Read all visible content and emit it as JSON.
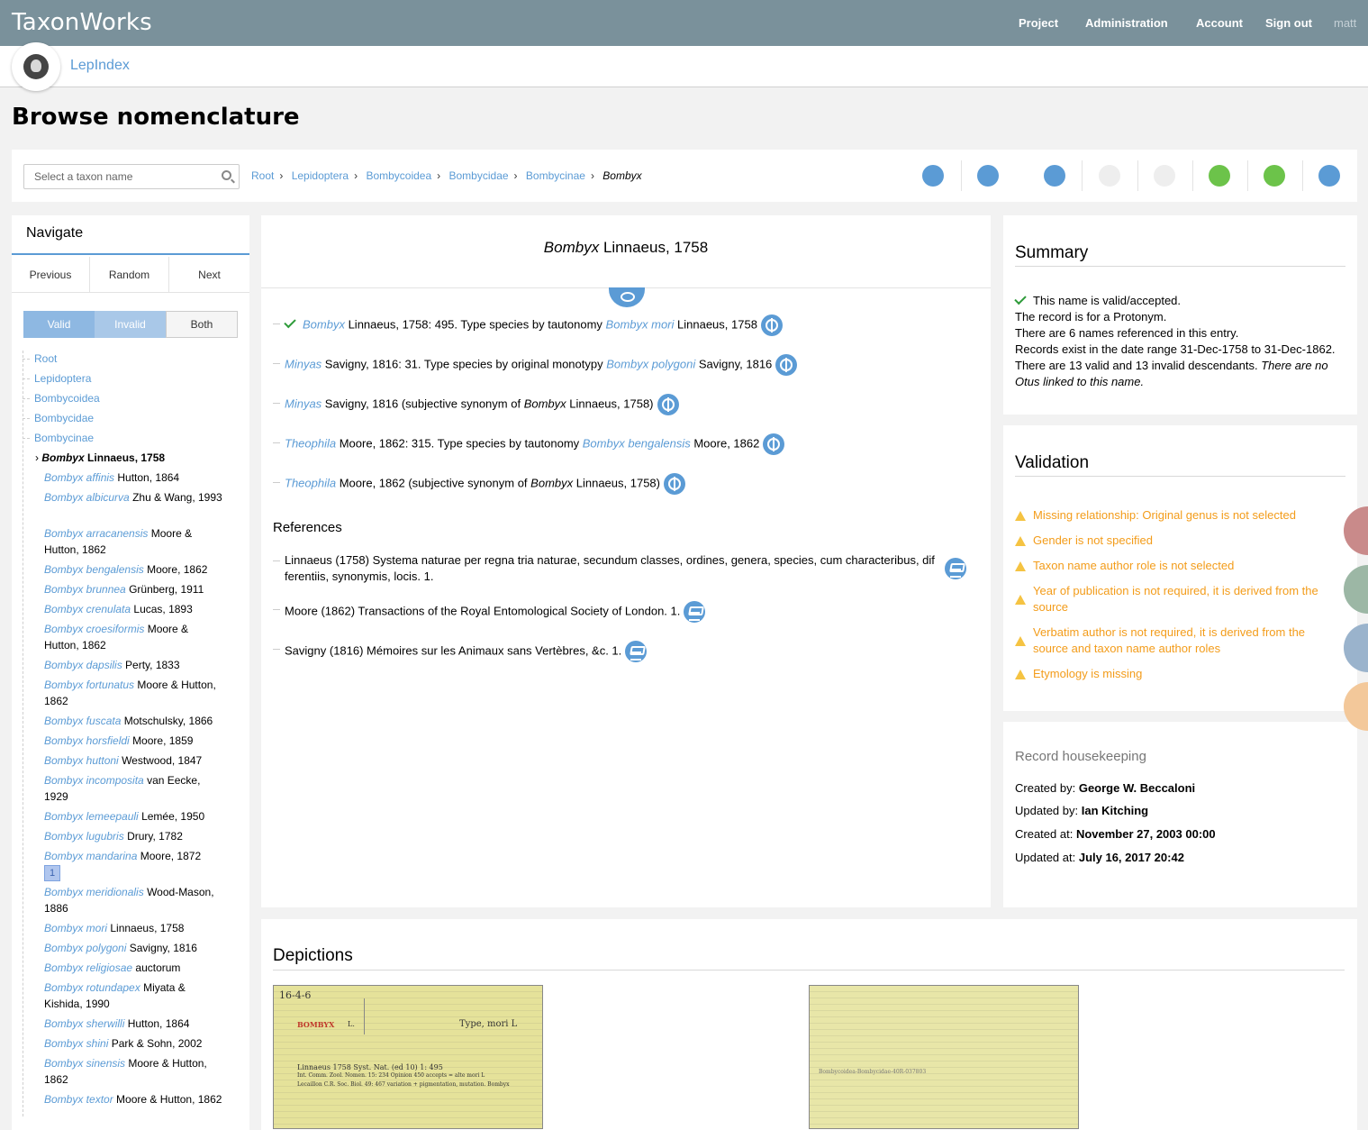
{
  "topbar": {
    "brand": "TaxonWorks",
    "nav": [
      "Project",
      "Administration",
      "Account",
      "Sign out"
    ],
    "user": "matt"
  },
  "project": {
    "name": "LepIndex"
  },
  "page_title": "Browse nomenclature",
  "search": {
    "placeholder": "Select a taxon name"
  },
  "breadcrumb": [
    "Root",
    "Lepidoptera",
    "Bombycoidea",
    "Bombycidae",
    "Bombycinae",
    "Bombyx"
  ],
  "toolbar_icons": [
    "radial-annotator-icon",
    "radial-object-icon",
    "radial-navigator-icon",
    "comprehensive-icon",
    "tag-icon",
    "pin-icon",
    "edit-icon",
    "citations-icon"
  ],
  "navigate": {
    "title": "Navigate",
    "buttons": [
      "Previous",
      "Random",
      "Next"
    ],
    "filter": [
      "Valid",
      "Invalid",
      "Both"
    ],
    "ancestors": [
      "Root",
      "Lepidoptera",
      "Bombycoidea",
      "Bombycidae",
      "Bombycinae"
    ],
    "current": {
      "name": "Bombyx",
      "author": "Linnaeus, 1758"
    },
    "children": [
      {
        "name": "Bombyx affinis",
        "author": "Hutton, 1864"
      },
      {
        "name": "Bombyx albicurva",
        "author": "Zhu & Wang, 1993"
      },
      {
        "name": "Bombyx arracanensis",
        "author": "Moore & Hutton, 1862"
      },
      {
        "name": "Bombyx bengalensis",
        "author": "Moore, 1862"
      },
      {
        "name": "Bombyx brunnea",
        "author": "Grünberg, 1911"
      },
      {
        "name": "Bombyx crenulata",
        "author": "Lucas, 1893"
      },
      {
        "name": "Bombyx croesiformis",
        "author": "Moore & Hutton, 1862"
      },
      {
        "name": "Bombyx dapsilis",
        "author": "Perty, 1833"
      },
      {
        "name": "Bombyx fortunatus",
        "author": "Moore & Hutton, 1862"
      },
      {
        "name": "Bombyx fuscata",
        "author": "Motschulsky, 1866"
      },
      {
        "name": "Bombyx horsfieldi",
        "author": "Moore, 1859"
      },
      {
        "name": "Bombyx huttoni",
        "author": "Westwood, 1847"
      },
      {
        "name": "Bombyx incomposita",
        "author": "van Eecke, 1929"
      },
      {
        "name": "Bombyx lemeepauli",
        "author": "Lemée, 1950"
      },
      {
        "name": "Bombyx lugubris",
        "author": "Drury, 1782"
      },
      {
        "name": "Bombyx mandarina",
        "author": "Moore, 1872",
        "count": "1"
      },
      {
        "name": "Bombyx meridionalis",
        "author": "Wood-Mason, 1886"
      },
      {
        "name": "Bombyx mori",
        "author": "Linnaeus, 1758"
      },
      {
        "name": "Bombyx polygoni",
        "author": "Savigny, 1816"
      },
      {
        "name": "Bombyx religiosae",
        "author": "auctorum"
      },
      {
        "name": "Bombyx rotundapex",
        "author": "Miyata & Kishida, 1990"
      },
      {
        "name": "Bombyx sherwilli",
        "author": "Hutton, 1864"
      },
      {
        "name": "Bombyx shini",
        "author": "Park & Sohn, 2002"
      },
      {
        "name": "Bombyx sinensis",
        "author": "Moore & Hutton, 1862"
      },
      {
        "name": "Bombyx textor",
        "author": "Moore & Hutton, 1862"
      }
    ]
  },
  "main": {
    "title_name": "Bombyx",
    "title_author": "Linnaeus, 1758",
    "entries": [
      {
        "a": "Bombyx",
        "b": " Linnaeus, 1758: 495. Type species by tautonomy ",
        "c": "Bombyx mori",
        "d": " Linnaeus, 1758"
      },
      {
        "a": "Minyas",
        "b": " Savigny, 1816: 31. Type species by original monotypy ",
        "c": "Bombyx polygoni",
        "d": " Savigny, 1816"
      },
      {
        "a": "Minyas",
        "b": " Savigny, 1816 (subjective synonym of ",
        "c": "Bombyx",
        "d": " Linnaeus, 1758)"
      },
      {
        "a": "Theophila",
        "b": " Moore, 1862: 315. Type species by tautonomy ",
        "c": "Bombyx bengalensis",
        "d": " Moore, 1862"
      },
      {
        "a": "Theophila",
        "b": " Moore, 1862 (subjective synonym of ",
        "c": "Bombyx",
        "d": " Linnaeus, 1758)"
      }
    ],
    "references_title": "References",
    "references": [
      "Linnaeus (1758) Systema naturae per regna tria naturae, secundum classes, ordines, genera, species, cum characteribus, dif",
      "ferentiis, synonymis, locis. 1.",
      "Moore (1862) Transactions of the Royal Entomological Society of London. 1.",
      "Savigny (1816) Mémoires sur les Animaux sans Vertèbres, &c. 1."
    ]
  },
  "summary": {
    "title": "Summary",
    "valid": "This name is valid/accepted.",
    "lines": [
      "The record is for a Protonym.",
      "There are 6 names referenced in this entry.",
      "Records exist in the date range 31-Dec-1758 to 31-Dec-1862.",
      "There are 13 valid and 13 invalid descendants. "
    ],
    "otus": "There are no Otus linked to this name."
  },
  "validation": {
    "title": "Validation",
    "items": [
      "Missing relationship: Original genus is not selected",
      "Gender is not specified",
      "Taxon name author role is not selected",
      "Year of publication is not required, it is derived from the source",
      "Verbatim author is not required, it is derived from the source and taxon name author roles",
      "Etymology is missing"
    ]
  },
  "housekeeping": {
    "title": "Record housekeeping",
    "created_by_label": "Created by:",
    "created_by": "George W. Beccaloni",
    "updated_by_label": "Updated by:",
    "updated_by": "Ian Kitching",
    "created_at_label": "Created at:",
    "created_at": "November 27, 2003 00:00",
    "updated_at_label": "Updated at:",
    "updated_at": "July 16, 2017 20:42"
  },
  "depictions": {
    "title": "Depictions",
    "image1": {
      "l1": "16-4-6",
      "l2": "BOMBYX",
      "l3": "L.",
      "l4": "Type, mori L",
      "l5": "Linnaeus 1758 Syst. Nat. (ed 10) 1: 495",
      "l6": "Int. Comm. Zool. Nomen. 15: 234 Opinion 450 accepts = alte mori L",
      "l7": "Lecaillon   C.R. Soc. Biol. 49: 467 variation + pigmentation, mutation. Bombyx"
    },
    "image2": {
      "l1": "Bombycoidea-Bombycidae-40R-037803"
    }
  },
  "colors": {
    "topbar": "#7a919b",
    "link": "#5b9bd5",
    "valid": "#2e9b3a",
    "warning": "#f39c1a"
  }
}
